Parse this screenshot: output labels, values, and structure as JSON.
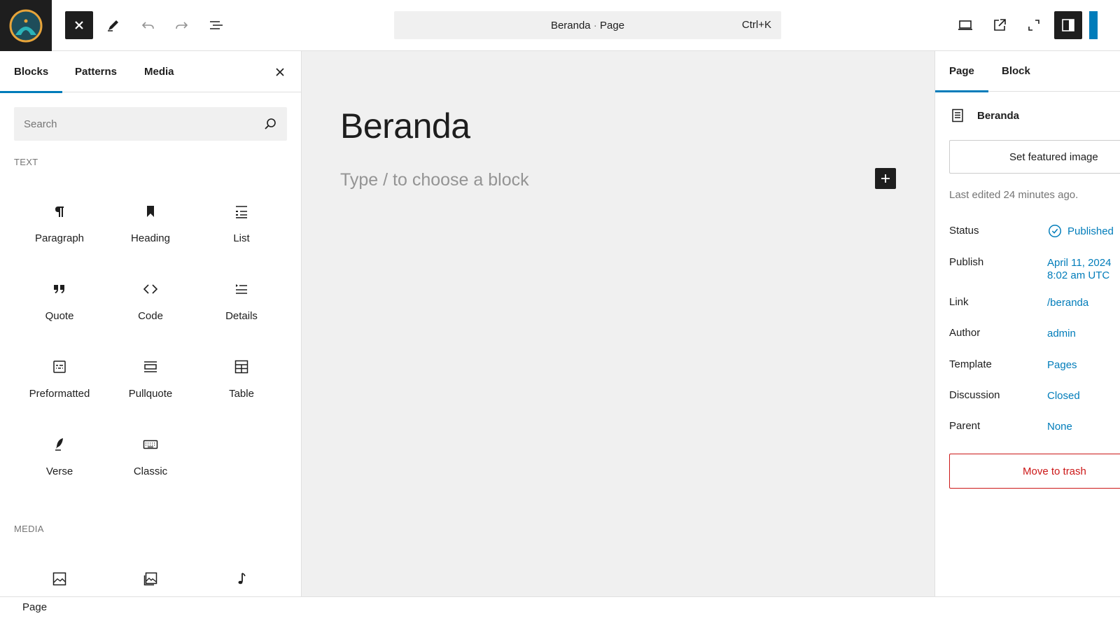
{
  "topbar": {
    "document_title": "Beranda",
    "document_separator": " · ",
    "document_type": "Page",
    "shortcut": "Ctrl+K"
  },
  "inserter": {
    "tabs": [
      "Blocks",
      "Patterns",
      "Media"
    ],
    "active_tab": "Blocks",
    "search_placeholder": "Search",
    "sections": {
      "text": "TEXT",
      "media": "MEDIA"
    },
    "text_blocks": [
      {
        "label": "Paragraph",
        "icon": "paragraph-icon"
      },
      {
        "label": "Heading",
        "icon": "heading-icon"
      },
      {
        "label": "List",
        "icon": "list-icon"
      },
      {
        "label": "Quote",
        "icon": "quote-icon"
      },
      {
        "label": "Code",
        "icon": "code-icon"
      },
      {
        "label": "Details",
        "icon": "details-icon"
      },
      {
        "label": "Preformatted",
        "icon": "preformatted-icon"
      },
      {
        "label": "Pullquote",
        "icon": "pullquote-icon"
      },
      {
        "label": "Table",
        "icon": "table-icon"
      },
      {
        "label": "Verse",
        "icon": "verse-icon"
      },
      {
        "label": "Classic",
        "icon": "classic-icon"
      }
    ],
    "media_blocks": [
      {
        "icon": "image-icon"
      },
      {
        "icon": "gallery-icon"
      },
      {
        "icon": "audio-icon"
      }
    ]
  },
  "canvas": {
    "title": "Beranda",
    "placeholder": "Type / to choose a block"
  },
  "settings": {
    "tabs": [
      "Page",
      "Block"
    ],
    "active_tab": "Page",
    "doc_name": "Beranda",
    "featured_image": "Set featured image",
    "last_edited": "Last edited 24 minutes ago.",
    "rows": [
      {
        "key": "Status",
        "value": "Published"
      },
      {
        "key": "Publish",
        "value": "April 11, 2024",
        "value2": "8:02 am UTC"
      },
      {
        "key": "Link",
        "value": "/beranda"
      },
      {
        "key": "Author",
        "value": "admin"
      },
      {
        "key": "Template",
        "value": "Pages"
      },
      {
        "key": "Discussion",
        "value": "Closed"
      },
      {
        "key": "Parent",
        "value": "None"
      }
    ],
    "trash_label": "Move to trash"
  },
  "footer": {
    "breadcrumb": "Page"
  },
  "colors": {
    "accent": "#007cba",
    "dark": "#1e1e1e",
    "danger": "#cc1818",
    "canvas_bg": "#f0f0f0"
  }
}
